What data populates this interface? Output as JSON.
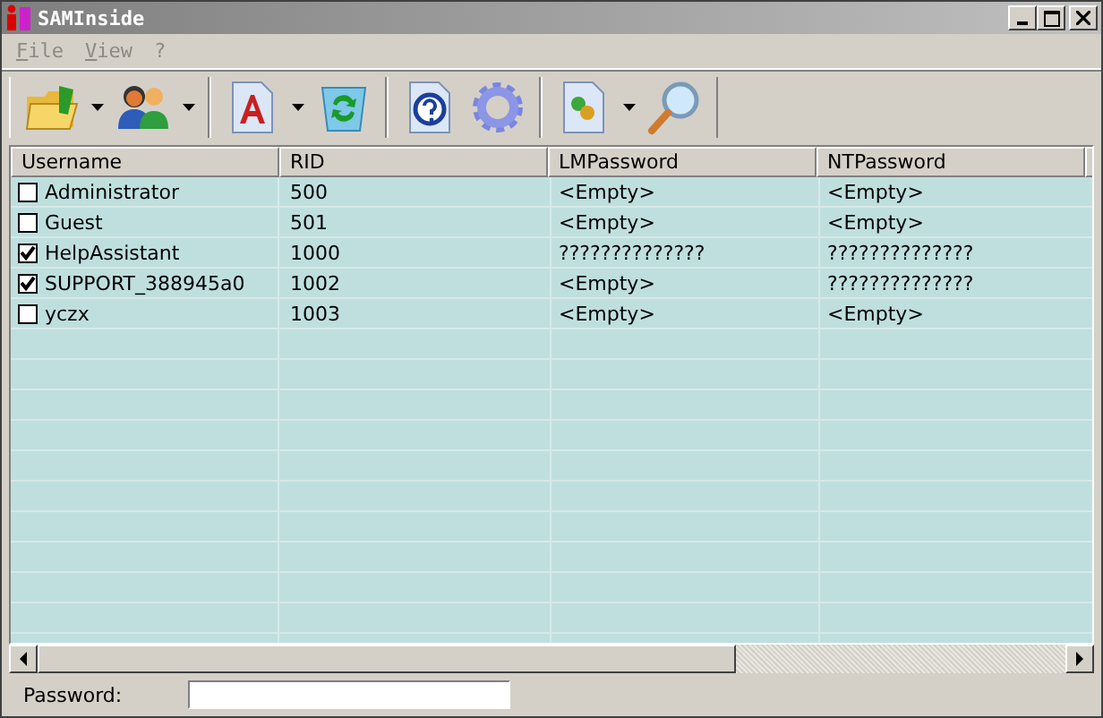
{
  "window": {
    "title": "SAMInside"
  },
  "menu": [
    {
      "label": "File"
    },
    {
      "label": "View"
    },
    {
      "label": "?"
    }
  ],
  "toolbar": [
    [
      {
        "kind": "open",
        "dropdown": true
      },
      {
        "kind": "users",
        "dropdown": true
      }
    ],
    [
      {
        "kind": "document",
        "dropdown": true
      },
      {
        "kind": "recycle",
        "dropdown": false
      }
    ],
    [
      {
        "kind": "help",
        "dropdown": false
      },
      {
        "kind": "gear",
        "dropdown": false
      }
    ],
    [
      {
        "kind": "plugin",
        "dropdown": true
      },
      {
        "kind": "search",
        "dropdown": false
      }
    ]
  ],
  "table": {
    "columns": [
      "Username",
      "RID",
      "LMPassword",
      "NTPassword"
    ],
    "rows": [
      {
        "checked": false,
        "cells": [
          "Administrator",
          "500",
          "<Empty>",
          "<Empty>"
        ]
      },
      {
        "checked": false,
        "cells": [
          "Guest",
          "501",
          "<Empty>",
          "<Empty>"
        ]
      },
      {
        "checked": true,
        "cells": [
          "HelpAssistant",
          "1000",
          "??????????????",
          "??????????????"
        ]
      },
      {
        "checked": true,
        "cells": [
          "SUPPORT_388945a0",
          "1002",
          "<Empty>",
          "??????????????"
        ]
      },
      {
        "checked": false,
        "cells": [
          "yczx",
          "1003",
          "<Empty>",
          "<Empty>"
        ]
      }
    ]
  },
  "password": {
    "label": "Password:"
  }
}
